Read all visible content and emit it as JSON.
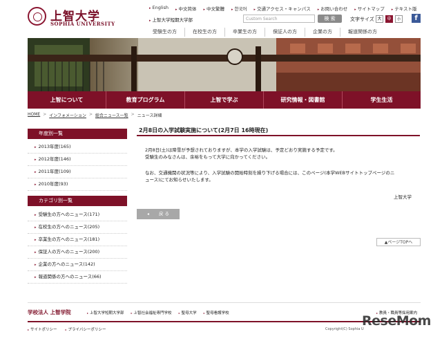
{
  "header": {
    "logo_jp": "上智大学",
    "logo_en": "SOPHIA UNIVERSITY",
    "top_links": [
      "English",
      "中文简体",
      "中文繁體",
      "한국어",
      "交通アクセス・キャンパス",
      "お問い合わせ",
      "サイトマップ",
      "テキスト版"
    ],
    "junior_college": "上智大学短期大学部",
    "search_placeholder": "Custom Search",
    "search_button": "検 索",
    "font_size_label": "文字サイズ",
    "font_large": "大",
    "font_medium": "中",
    "font_small": "小",
    "facebook": "f",
    "audience_nav": [
      "受験生の方",
      "在校生の方",
      "卒業生の方",
      "保証人の方",
      "企業の方",
      "報道関係の方"
    ]
  },
  "main_nav": [
    "上智について",
    "教育プログラム",
    "上智で学ぶ",
    "研究情報・図書館",
    "学生生活"
  ],
  "breadcrumb": [
    "HOME",
    "インフォメーション",
    "総合ニュース一覧",
    "ニュース詳細"
  ],
  "sidebar": {
    "year_heading": "年度別一覧",
    "years": [
      "2013年度(165)",
      "2012年度(146)",
      "2011年度(109)",
      "2010年度(93)"
    ],
    "category_heading": "カテゴリ別一覧",
    "categories": [
      "受験生の方へのニュース(171)",
      "在校生の方へのニュース(205)",
      "卒業生の方へのニュース(181)",
      "保証人の方へのニュース(200)",
      "企業の方へのニュース(142)",
      "報道関係の方へのニュース(66)"
    ]
  },
  "article": {
    "title": "2月8日の入学試験実施について(2月7日 16時現在)",
    "p1a": "2月8日(土)は降雪が予想されておりますが、本学の入学試験は、予定どおり実施する予定です。",
    "p1b": "受験生のみなさんは、余裕をもって大学に向かってください。",
    "p2a": "なお、交通機関の状況等により、入学試験の開始時刻を繰り下げる場合には、このページ(本学WEBサイトトップページのニ",
    "p2b": "ュース)にてお知らせいたします。",
    "signature": "上智大学",
    "back_button": "戻 る",
    "page_top": "▲ページTOPへ"
  },
  "footer": {
    "org": "学校法人 上智学院",
    "links": [
      "上智大学短期大学部",
      "上智社会福祉専門学校",
      "聖母大学",
      "聖母看護学校"
    ],
    "recruit": "教員・職員等採用案内",
    "bottom_links": [
      "サイトポリシー",
      "プライバシーポリシー"
    ],
    "copyright": "Copyright(C) Sophia U",
    "watermark": "ReseMom"
  }
}
